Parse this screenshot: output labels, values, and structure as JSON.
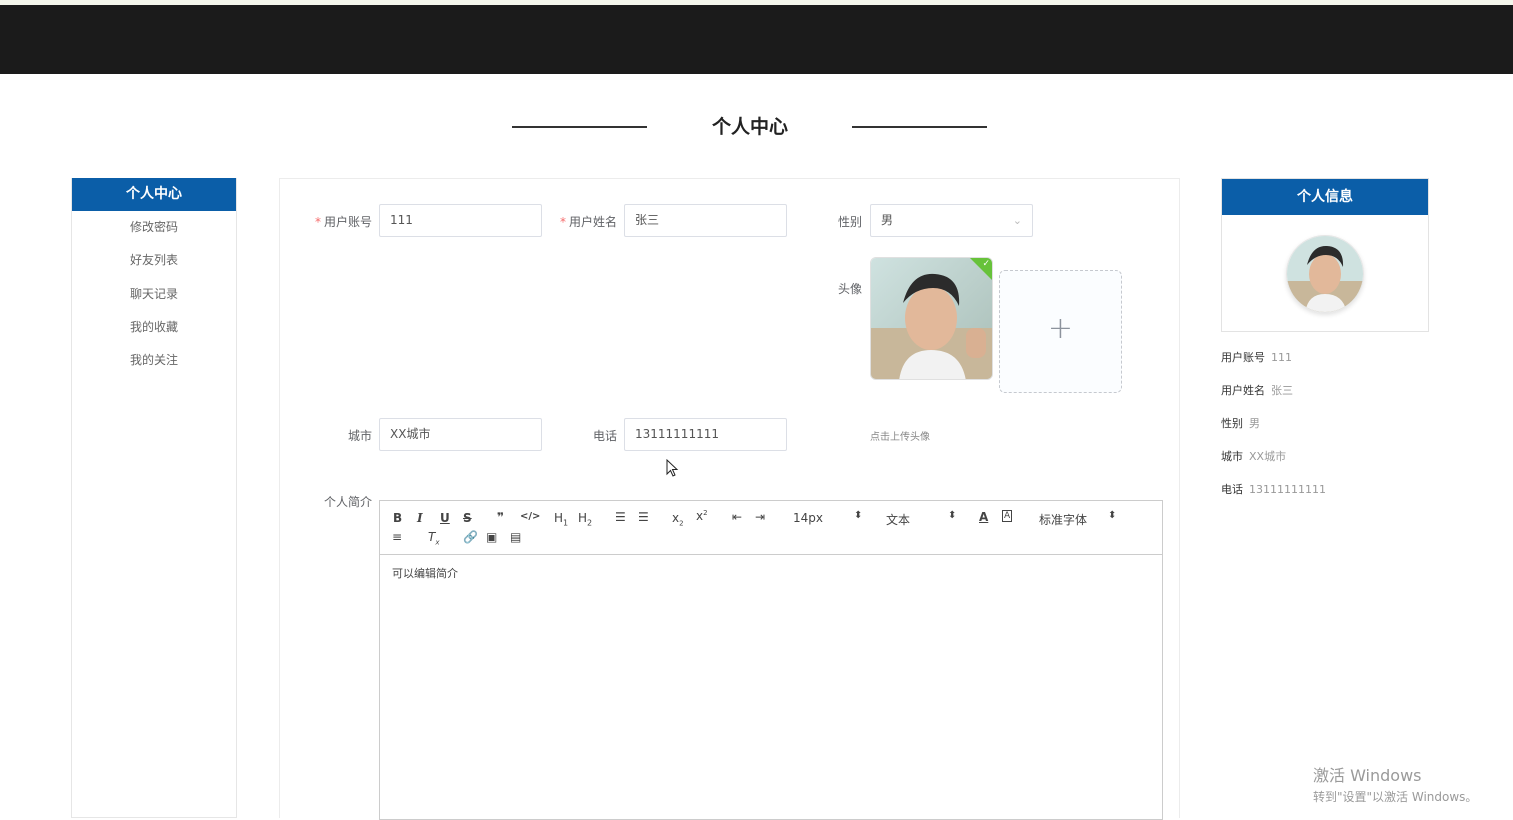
{
  "page": {
    "title": "个人中心"
  },
  "left_menu": {
    "header": "个人中心",
    "items": [
      "修改密码",
      "好友列表",
      "聊天记录",
      "我的收藏",
      "我的关注"
    ]
  },
  "form": {
    "account_label": "用户账号",
    "account_value": "111",
    "name_label": "用户姓名",
    "name_value": "张三",
    "gender_label": "性别",
    "gender_value": "男",
    "avatar_label": "头像",
    "upload_plus": "+",
    "upload_hint": "点击上传头像",
    "city_label": "城市",
    "city_value": "XX城市",
    "phone_label": "电话",
    "phone_value": "13111111111",
    "bio_label": "个人简介",
    "required_mark": "*",
    "editor": {
      "font_size": "14px",
      "header": "文本",
      "font_family": "标准字体",
      "content": "可以编辑简介"
    }
  },
  "info_panel": {
    "header": "个人信息",
    "rows": [
      {
        "label": "用户账号",
        "value": "111"
      },
      {
        "label": "用户姓名",
        "value": "张三"
      },
      {
        "label": "性别",
        "value": "男"
      },
      {
        "label": "城市",
        "value": "XX城市"
      },
      {
        "label": "电话",
        "value": "13111111111"
      }
    ]
  },
  "watermark": {
    "line1": "激活 Windows",
    "line2": "转到\"设置\"以激活 Windows。"
  },
  "colors": {
    "primary": "#0b5ea8",
    "topbar": "#1b1b1b",
    "required": "#f56c6c",
    "check": "#67c23a"
  }
}
